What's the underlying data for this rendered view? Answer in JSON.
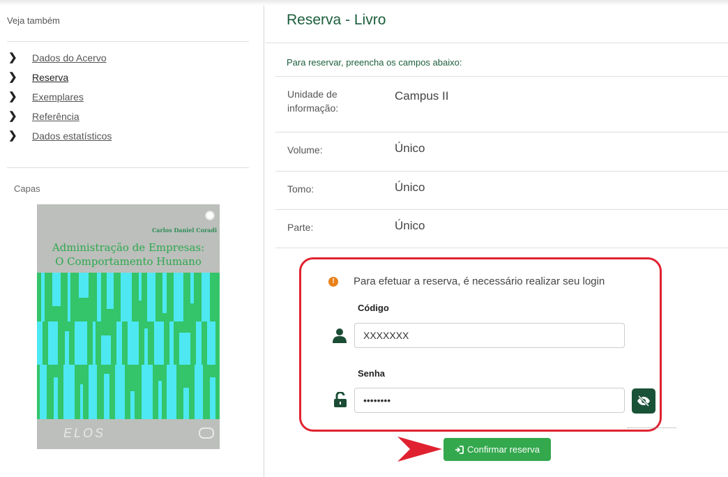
{
  "sidebar": {
    "see_also": "Veja também",
    "nav": [
      {
        "label": "Dados do Acervo"
      },
      {
        "label": "Reserva"
      },
      {
        "label": "Exemplares"
      },
      {
        "label": "Referência"
      },
      {
        "label": "Dados estatísticos"
      }
    ],
    "capas": "Capas",
    "cover": {
      "author": "Carlos Daniel Coradi",
      "title_line1": "Administração de Empresas:",
      "title_line2": "O Comportamento Humano",
      "publisher": "ELOS"
    }
  },
  "main": {
    "title": "Reserva - Livro",
    "intro": "Para reservar, preencha os campos abaixo:",
    "rows": [
      {
        "label_line1": "Unidade de",
        "label_line2": "informação:",
        "value": "Campus II"
      },
      {
        "label": "Volume:",
        "value": "Único"
      },
      {
        "label": "Tomo:",
        "value": "Único"
      },
      {
        "label": "Parte:",
        "value": "Único"
      }
    ],
    "login": {
      "warning": "Para efetuar a reserva, é necessário realizar seu login",
      "code_label": "Código",
      "code_value": "XXXXXXX",
      "password_label": "Senha",
      "password_value": "••••••••"
    },
    "confirm_label": "Confirmar reserva"
  },
  "colors": {
    "brand_green": "#1b5e3b",
    "button_green": "#33a84d",
    "highlight_red": "#e02230",
    "warning_orange": "#e8811a"
  }
}
